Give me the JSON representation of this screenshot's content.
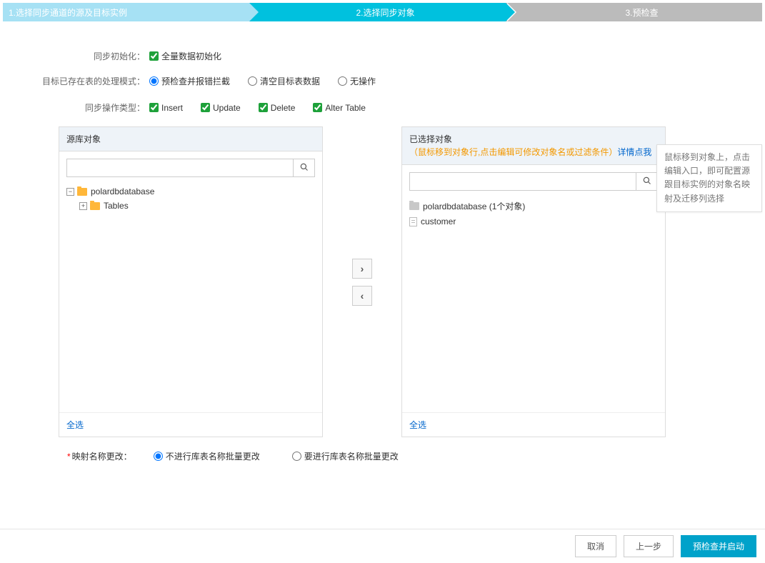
{
  "steps": {
    "s1": "1.选择同步通道的源及目标实例",
    "s2": "2.选择同步对象",
    "s3": "3.预检查"
  },
  "init": {
    "label": "同步初始化：",
    "full": "全量数据初始化"
  },
  "exist": {
    "label": "目标已存在表的处理模式：",
    "opt1": "预检查并报错拦截",
    "opt2": "清空目标表数据",
    "opt3": "无操作"
  },
  "ops": {
    "label": "同步操作类型：",
    "insert": "Insert",
    "update": "Update",
    "delete": "Delete",
    "alter": "Alter Table"
  },
  "source_panel": {
    "title": "源库对象",
    "root": "polardbdatabase",
    "child": "Tables",
    "select_all": "全选"
  },
  "target_panel": {
    "title": "已选择对象",
    "hint": "（鼠标移到对象行,点击编辑可修改对象名或过滤条件）",
    "link": "详情点我",
    "root": "polardbdatabase (1个对象)",
    "child": "customer",
    "select_all": "全选"
  },
  "tooltip": "鼠标移到对象上，点击编辑入口，即可配置源跟目标实例的对象名映射及迁移列选择",
  "rename": {
    "label": "映射名称更改：",
    "opt1": "不进行库表名称批量更改",
    "opt2": "要进行库表名称批量更改"
  },
  "buttons": {
    "cancel": "取消",
    "prev": "上一步",
    "next": "预检查并启动"
  }
}
